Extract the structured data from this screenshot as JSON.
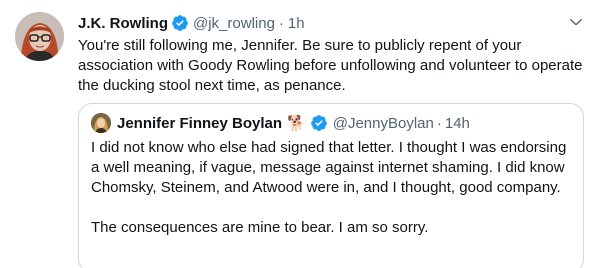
{
  "tweet": {
    "author_name": "J.K. Rowling",
    "handle": "@jk_rowling",
    "separator": "·",
    "time": "1h",
    "text": "You're still following me, Jennifer. Be sure to publicly repent of your association with Goody Rowling before unfollowing and volunteer to operate the ducking stool next time, as penance.",
    "icons": {
      "verified": "verified-badge-icon",
      "more": "chevron-down-icon"
    }
  },
  "quoted_tweet": {
    "author_name": "Jennifer Finney Boylan",
    "name_emoji": "🐕",
    "handle": "@JennyBoylan",
    "separator": "·",
    "time": "14h",
    "paragraph_1": "I did not know who else had signed that letter.  I thought I was endorsing a well meaning, if vague, message against internet shaming. I did know Chomsky, Steinem, and Atwood were in, and I thought, good company.",
    "paragraph_2": "The consequences are mine to bear. I am so sorry."
  },
  "colors": {
    "text": "#0f1419",
    "secondary": "#536471",
    "verified": "#1d9bf0",
    "border": "#cfd9de"
  }
}
